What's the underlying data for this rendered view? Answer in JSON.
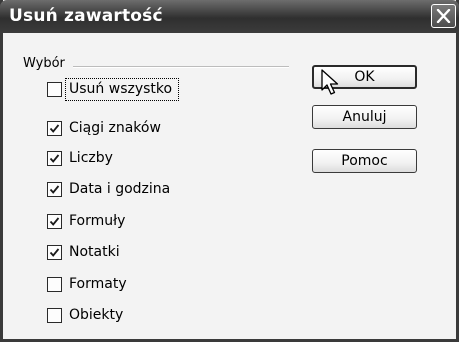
{
  "window": {
    "title": "Usuń zawartość",
    "close_icon": "close-x-icon"
  },
  "group": {
    "label": "Wybór"
  },
  "options": [
    {
      "label": "Usuń wszystko",
      "checked": false
    },
    {
      "label": "Ciągi znaków",
      "checked": true
    },
    {
      "label": "Liczby",
      "checked": true
    },
    {
      "label": "Data i godzina",
      "checked": true
    },
    {
      "label": "Formuły",
      "checked": true
    },
    {
      "label": "Notatki",
      "checked": true
    },
    {
      "label": "Formaty",
      "checked": false
    },
    {
      "label": "Obiekty",
      "checked": false
    }
  ],
  "buttons": {
    "ok": "OK",
    "cancel": "Anuluj",
    "help": "Pomoc"
  },
  "cursor_icon": "mouse-pointer-icon"
}
